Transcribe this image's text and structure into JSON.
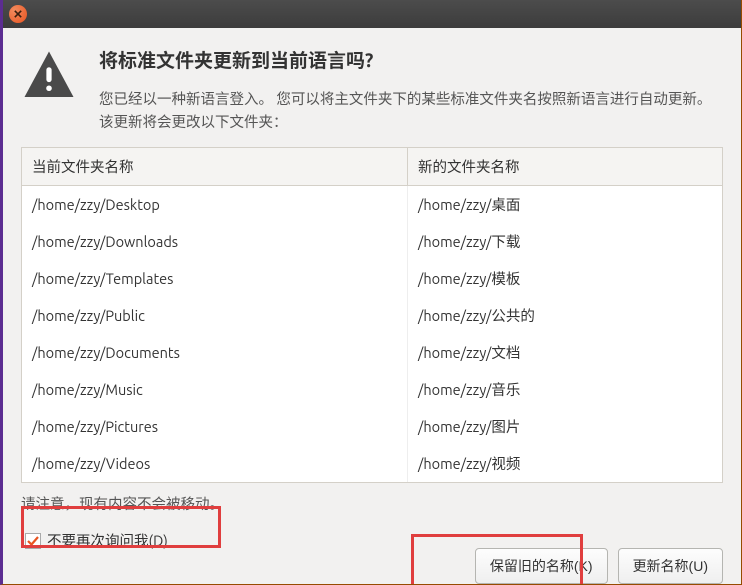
{
  "dialog": {
    "title": "将标准文件夹更新到当前语言吗?",
    "subtitle": "您已经以一种新语言登入。 您可以将主文件夹下的某些标准文件夹名按照新语言进行自动更新。该更新将会更改以下文件夹：",
    "table": {
      "headers": {
        "current": "当前文件夹名称",
        "new": "新的文件夹名称"
      },
      "rows": [
        {
          "current": "/home/zzy/Desktop",
          "new": "/home/zzy/桌面"
        },
        {
          "current": "/home/zzy/Downloads",
          "new": "/home/zzy/下载"
        },
        {
          "current": "/home/zzy/Templates",
          "new": "/home/zzy/模板"
        },
        {
          "current": "/home/zzy/Public",
          "new": "/home/zzy/公共的"
        },
        {
          "current": "/home/zzy/Documents",
          "new": "/home/zzy/文档"
        },
        {
          "current": "/home/zzy/Music",
          "new": "/home/zzy/音乐"
        },
        {
          "current": "/home/zzy/Pictures",
          "new": "/home/zzy/图片"
        },
        {
          "current": "/home/zzy/Videos",
          "new": "/home/zzy/视频"
        }
      ]
    },
    "note": "请注意，现有内容不会被移动。",
    "checkbox": {
      "label": "不要再次询问我(D)",
      "checked": true
    },
    "buttons": {
      "keep": "保留旧的名称(K)",
      "update": "更新名称(U)"
    }
  },
  "colors": {
    "accent": "#e95420",
    "highlight": "#e03e3e"
  }
}
